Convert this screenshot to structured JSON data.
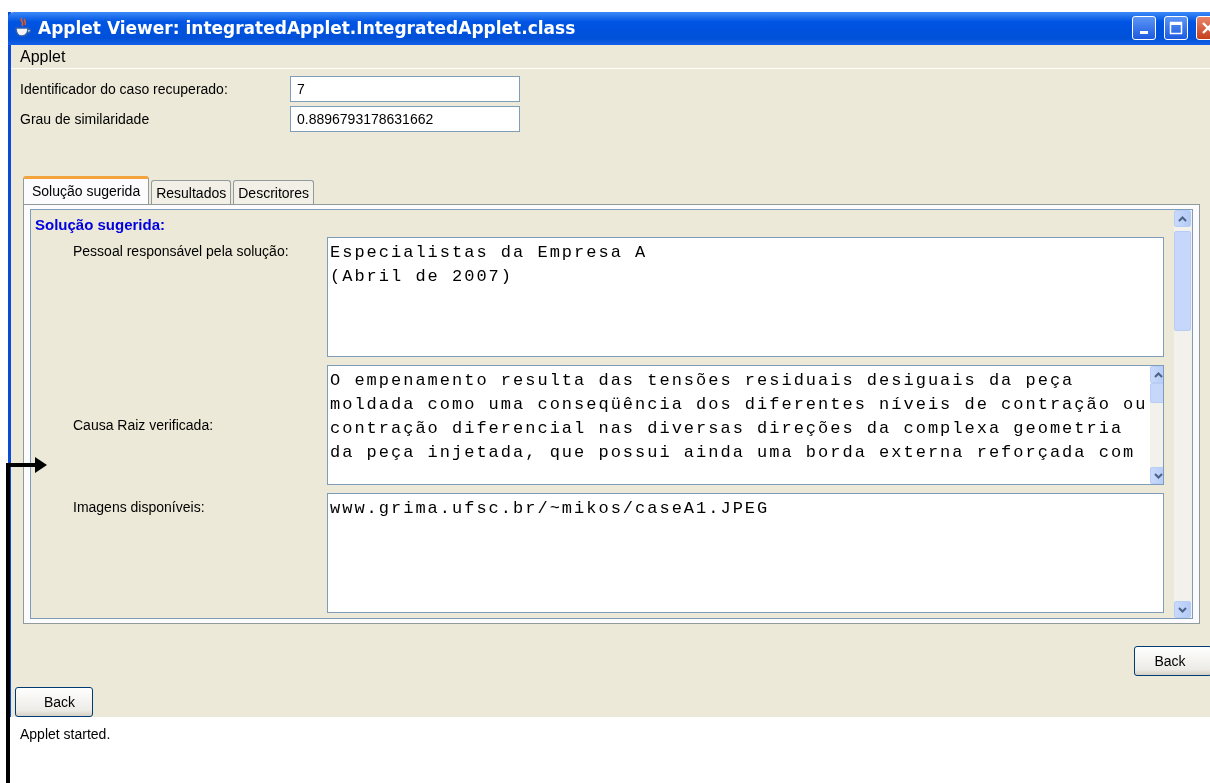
{
  "window": {
    "title": "Applet Viewer: integratedApplet.IntegratedApplet.class"
  },
  "menu": [
    "Applet"
  ],
  "fields": [
    {
      "label": "Identificador do caso recuperado:",
      "value": "7"
    },
    {
      "label": "Grau de similaridade",
      "value": "0.8896793178631662"
    }
  ],
  "tabs": [
    {
      "label": "Solução sugerida",
      "selected": true
    },
    {
      "label": "Resultados",
      "selected": false
    },
    {
      "label": "Descritores",
      "selected": false
    }
  ],
  "panel": {
    "heading": "Solução sugerida:",
    "rows": [
      {
        "label": "Pessoal responsável pela solução:",
        "scrollbar": false,
        "lines": [
          "Especialistas da Empresa A",
          "(Abril de 2007)"
        ]
      },
      {
        "label": "Causa Raiz verificada:",
        "scrollbar": true,
        "lines": [
          "O empenamento resulta das tensões residuais desiguais da peça",
          "moldada como uma conseqüência dos diferentes níveis de contração ou",
          "contração diferencial nas diversas direções da complexa geometria",
          "da peça injetada, que possui ainda uma borda externa reforçada com"
        ]
      },
      {
        "label": "Imagens disponíveis:",
        "scrollbar": false,
        "lines": [
          "www.grima.ufsc.br/~mikos/caseA1.JPEG"
        ]
      }
    ]
  },
  "buttons": [
    "Back",
    "Back"
  ],
  "status_bar": "Applet started."
}
